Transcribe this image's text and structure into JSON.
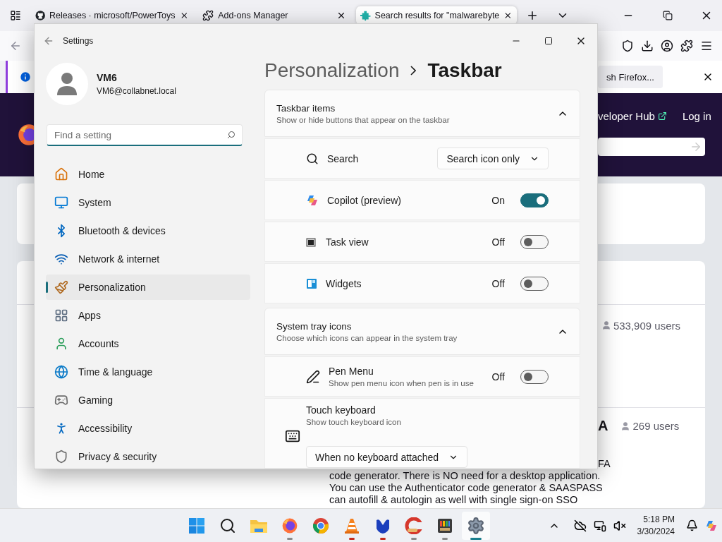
{
  "browser": {
    "tabs": [
      {
        "title": "Releases · microsoft/PowerToys",
        "selected": false
      },
      {
        "title": "Add-ons Manager",
        "selected": false
      },
      {
        "title": "Search results for \"malwarebyte",
        "selected": true
      }
    ],
    "notification": {
      "button": "sh Firefox..."
    },
    "header": {
      "links": [
        "veloper Hub",
        "Log in"
      ]
    },
    "results": [
      {
        "users": "533,909 users"
      },
      {
        "title": "A",
        "users": "269 users",
        "description_tail": "FA",
        "description": [
          "code generator. There is NO need for a desktop application.",
          "You can use the Authenticator code generator & SAASPASS",
          "can autofill & autologin as well with single sign-on SSO"
        ]
      }
    ]
  },
  "settings": {
    "title": "Settings",
    "user": {
      "name": "VM6",
      "email": "VM6@collabnet.local"
    },
    "search": {
      "placeholder": "Find a setting"
    },
    "nav": [
      {
        "label": "Home",
        "selected": false
      },
      {
        "label": "System",
        "selected": false
      },
      {
        "label": "Bluetooth & devices",
        "selected": false
      },
      {
        "label": "Network & internet",
        "selected": false
      },
      {
        "label": "Personalization",
        "selected": true
      },
      {
        "label": "Apps",
        "selected": false
      },
      {
        "label": "Accounts",
        "selected": false
      },
      {
        "label": "Time & language",
        "selected": false
      },
      {
        "label": "Gaming",
        "selected": false
      },
      {
        "label": "Accessibility",
        "selected": false
      },
      {
        "label": "Privacy & security",
        "selected": false
      }
    ],
    "breadcrumb": {
      "parent": "Personalization",
      "current": "Taskbar"
    },
    "groups": [
      {
        "title": "Taskbar items",
        "subtitle": "Show or hide buttons that appear on the taskbar",
        "expanded": true,
        "rows": [
          {
            "kind": "dropdown",
            "label": "Search",
            "value": "Search icon only"
          },
          {
            "kind": "toggle",
            "label": "Copilot (preview)",
            "state": "On",
            "on": true
          },
          {
            "kind": "toggle",
            "label": "Task view",
            "state": "Off",
            "on": false
          },
          {
            "kind": "toggle",
            "label": "Widgets",
            "state": "Off",
            "on": false
          }
        ]
      },
      {
        "title": "System tray icons",
        "subtitle": "Choose which icons can appear in the system tray",
        "expanded": true,
        "rows": [
          {
            "kind": "toggle",
            "label": "Pen Menu",
            "subtitle": "Show pen menu icon when pen is in use",
            "state": "Off",
            "on": false
          },
          {
            "kind": "dropdown-below",
            "label": "Touch keyboard",
            "subtitle": "Show touch keyboard icon",
            "value": "When no keyboard attached"
          }
        ]
      }
    ]
  },
  "taskbar": {
    "apps": [
      {
        "selected": false
      },
      {
        "selected": false
      },
      {
        "selected": false
      },
      {
        "selected": false,
        "color": "#8a8a8a"
      },
      {
        "selected": false
      },
      {
        "selected": false,
        "color": "#c42b1c"
      },
      {
        "selected": false,
        "color": "#c42b1c"
      },
      {
        "selected": false,
        "color": "#8a8a8a"
      },
      {
        "selected": false,
        "color": "#8a8a8a"
      },
      {
        "selected": true,
        "color": "#1a7f8e"
      }
    ],
    "time": "5:18 PM",
    "date": "3/30/2024"
  }
}
